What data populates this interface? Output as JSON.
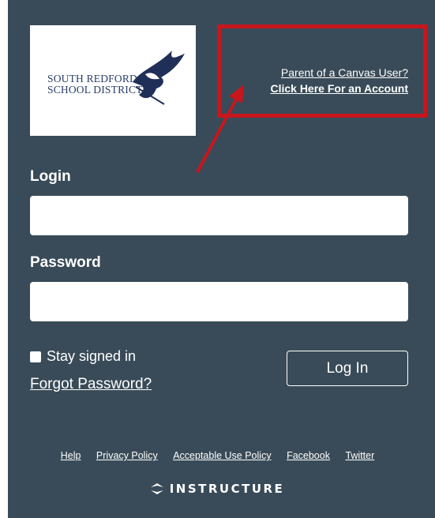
{
  "logo": {
    "line1": "SOUTH REDFORD",
    "line2": "SCHOOL DISTRICT"
  },
  "parent": {
    "line1": "Parent of a Canvas User?",
    "line2": "Click Here For an Account"
  },
  "form": {
    "login_label": "Login",
    "password_label": "Password",
    "login_value": "",
    "password_value": "",
    "stay_signed_in": "Stay signed in",
    "forgot_password": "Forgot Password?",
    "login_button": "Log In"
  },
  "footer": {
    "links": [
      "Help",
      "Privacy Policy",
      "Acceptable Use Policy",
      "Facebook",
      "Twitter"
    ],
    "brand": "INSTRUCTURE"
  },
  "colors": {
    "panel": "#394b58",
    "highlight": "#c8161d",
    "logo_text": "#2a3f6a"
  }
}
